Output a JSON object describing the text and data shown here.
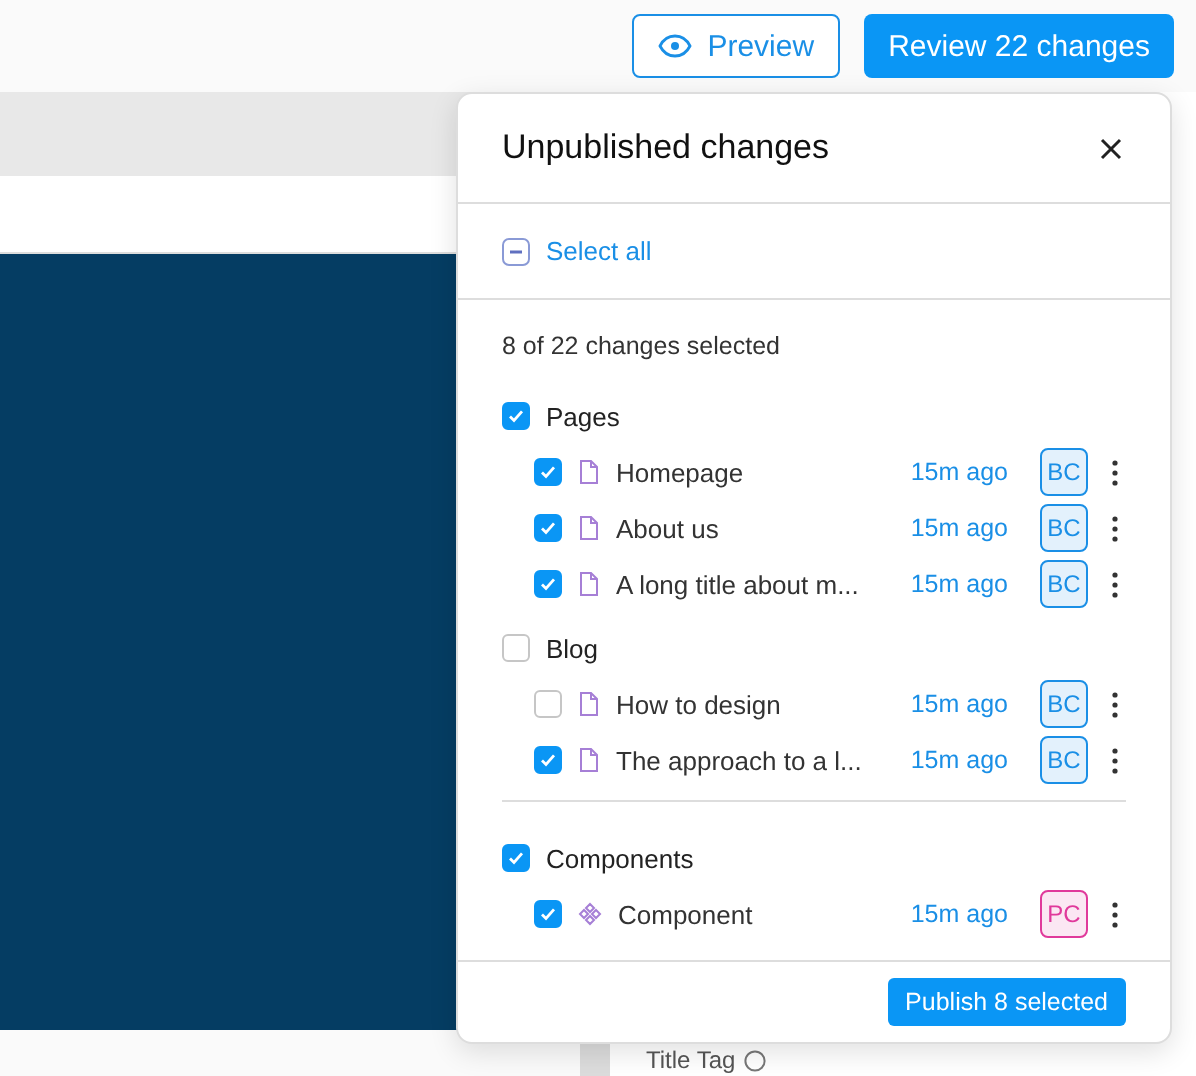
{
  "toolbar": {
    "preview": "Preview",
    "review": "Review 22 changes"
  },
  "editor": {
    "field_label": "Title Tag"
  },
  "panel": {
    "title": "Unpublished changes",
    "select_all": {
      "label": "Select all",
      "partial": true
    },
    "summary": "8 of 22 changes selected",
    "groups": [
      {
        "label": "Pages",
        "checked": true,
        "items": [
          {
            "title": "Homepage",
            "kind": "page",
            "checked": true,
            "time": "15m ago",
            "avatar": "BC",
            "color": "#1a8fe6"
          },
          {
            "title": "About us",
            "kind": "page",
            "checked": true,
            "time": "15m ago",
            "avatar": "BC",
            "color": "#1a8fe6"
          },
          {
            "title": "A long title about m...",
            "kind": "page",
            "checked": true,
            "time": "15m ago",
            "avatar": "BC",
            "color": "#1a8fe6"
          }
        ]
      },
      {
        "label": "Blog",
        "checked": false,
        "items": [
          {
            "title": "How to design",
            "kind": "page",
            "checked": false,
            "time": "15m ago",
            "avatar": "BC",
            "color": "#1a8fe6"
          },
          {
            "title": "The approach to a l...",
            "kind": "page",
            "checked": true,
            "time": "15m ago",
            "avatar": "BC",
            "color": "#1a8fe6"
          }
        ]
      },
      {
        "label": "Components",
        "checked": true,
        "divider": true,
        "items": [
          {
            "title": "Component",
            "kind": "component",
            "checked": true,
            "time": "15m ago",
            "avatar": "PC",
            "color": "#e0399b"
          }
        ]
      }
    ],
    "publish": "Publish 8 selected"
  }
}
